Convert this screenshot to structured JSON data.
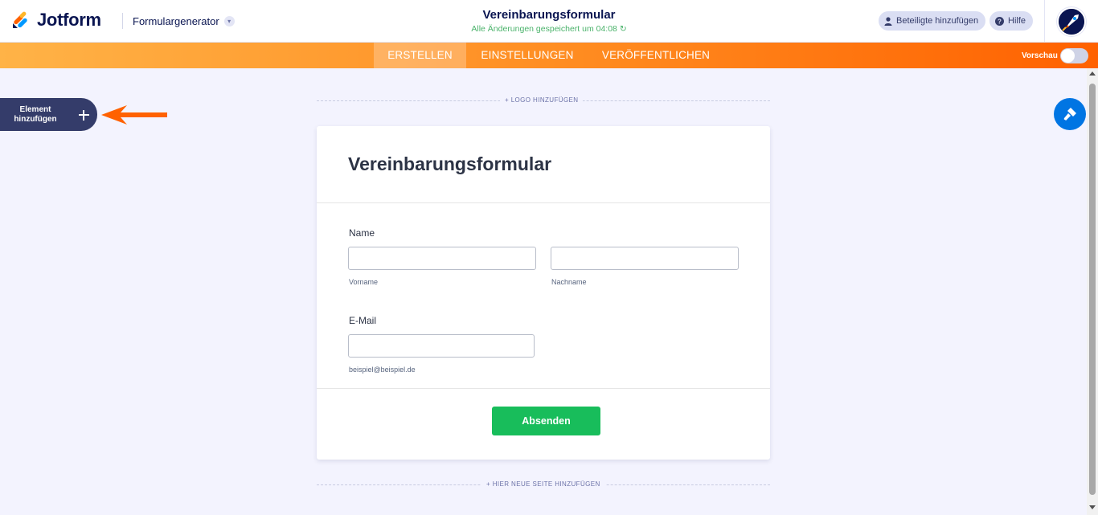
{
  "header": {
    "logo_text": "Jotform",
    "builder_label": "Formulargenerator",
    "form_title": "Vereinbarungsformular",
    "saved_status": "Alle Änderungen gespeichert um 04:08",
    "add_participants_label": "Beteiligte hinzufügen",
    "help_label": "Hilfe"
  },
  "nav": {
    "tabs": [
      {
        "label": "ERSTELLEN",
        "active": true
      },
      {
        "label": "EINSTELLUNGEN",
        "active": false
      },
      {
        "label": "VERÖFFENTLICHEN",
        "active": false
      }
    ],
    "preview_label": "Vorschau",
    "preview_enabled": false
  },
  "left_panel": {
    "add_element_label": "Element hinzufügen"
  },
  "form": {
    "add_logo_label": "+ LOGO HINZUFÜGEN",
    "title": "Vereinbarungsformular",
    "fields": [
      {
        "label": "Name",
        "sublabels": [
          "Vorname",
          "Nachname"
        ],
        "values": [
          "",
          ""
        ]
      },
      {
        "label": "E-Mail",
        "sublabels": [
          "beispiel@beispiel.de"
        ],
        "values": [
          ""
        ]
      }
    ],
    "submit_label": "Absenden",
    "add_page_label": "+ HIER NEUE SEITE HINZUFÜGEN"
  },
  "colors": {
    "accent_orange": "#ff6100",
    "submit_green": "#18bd5b",
    "designer_blue": "#0075e3",
    "dark_navy": "#343c6a"
  },
  "icons": [
    "jotform-logo-icon",
    "chevron-down-icon",
    "user-icon",
    "help-icon",
    "rocket-avatar-icon",
    "plus-icon",
    "arrow-left-icon",
    "paint-roller-icon",
    "refresh-icon"
  ]
}
